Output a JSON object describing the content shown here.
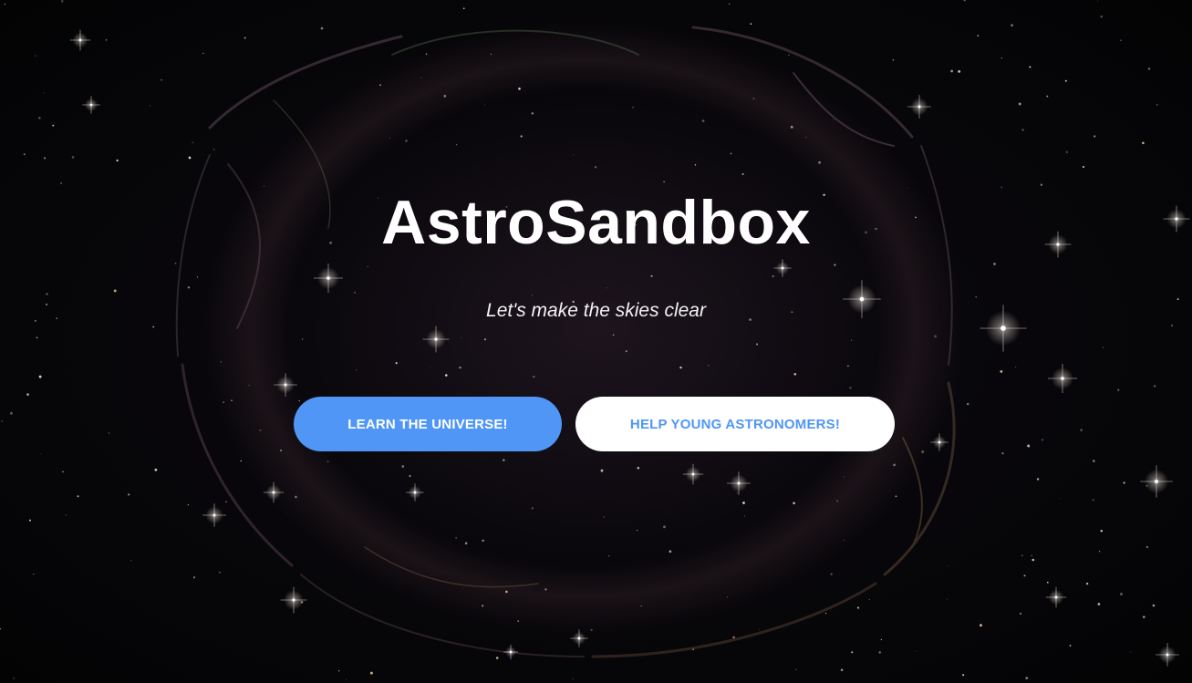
{
  "hero": {
    "title": "AstroSandbox",
    "subtitle": "Let's make the skies clear",
    "primary_button_label": "LEARN THE UNIVERSE!",
    "secondary_button_label": "HELP YOUNG ASTRONOMERS!"
  },
  "colors": {
    "accent": "#4f96f7",
    "background": "#050407",
    "text": "#ffffff"
  }
}
